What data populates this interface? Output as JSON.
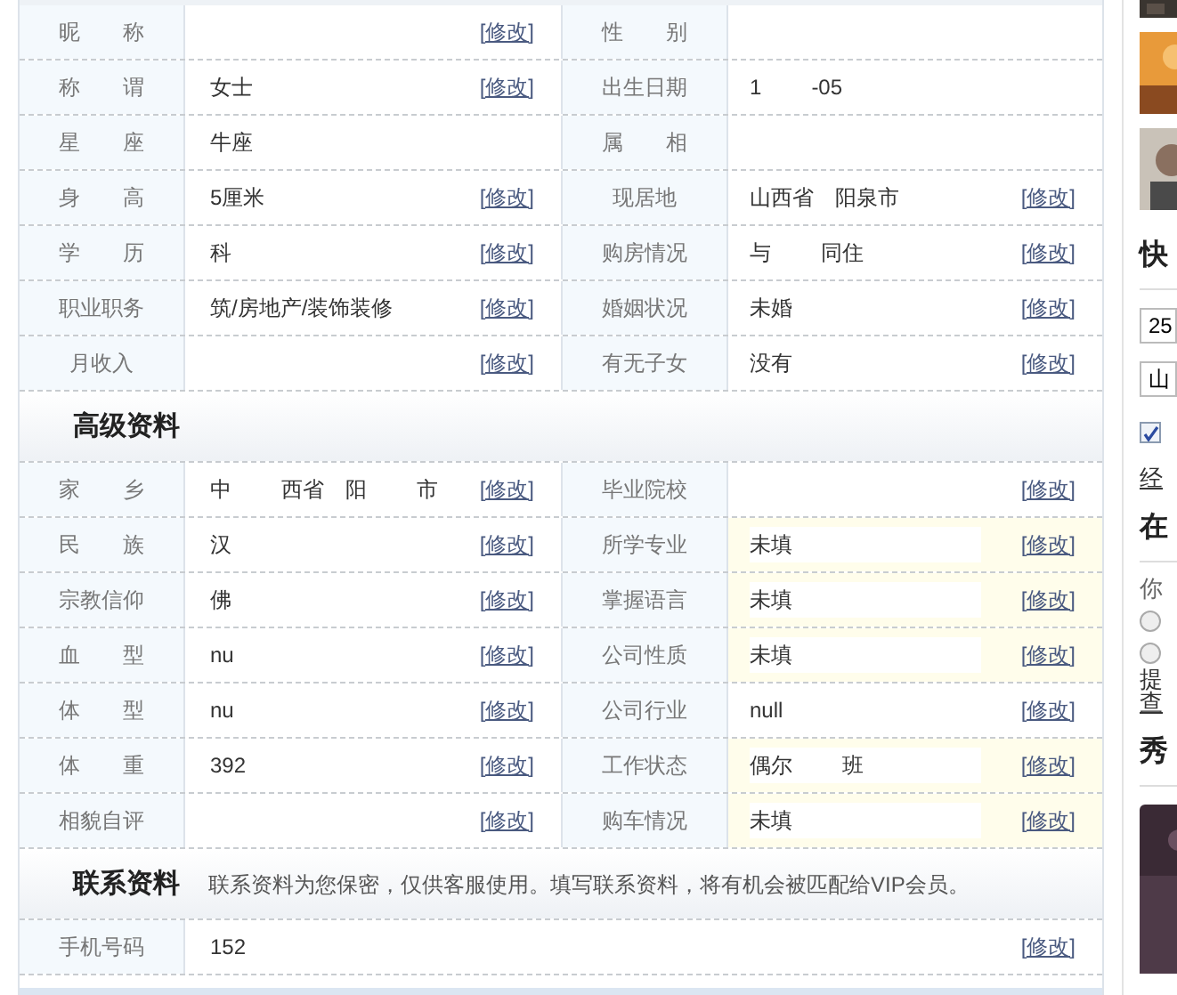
{
  "basic": {
    "rows": [
      {
        "left": {
          "label": "昵　　称",
          "edit": "[修改]"
        },
        "right": {
          "label": "性　　别",
          "highlighted": false
        }
      },
      {
        "left": {
          "label": "称　　谓",
          "value": "女士",
          "edit": "[修改]"
        },
        "right": {
          "label": "出生日期",
          "value": "1",
          "value2": "-05",
          "highlighted": false
        }
      },
      {
        "left": {
          "label": "星　　座",
          "value": "牛座"
        },
        "right": {
          "label": "属　　相",
          "highlighted": false
        }
      },
      {
        "left": {
          "label": "身　　高",
          "value": "5厘米",
          "edit": "[修改]"
        },
        "right": {
          "label": "现居地",
          "value": "山西省　阳泉市",
          "edit": "[修改]",
          "highlighted": false
        }
      },
      {
        "left": {
          "label": "学　　历",
          "value": "科",
          "edit": "[修改]"
        },
        "right": {
          "label": "购房情况",
          "value": "与",
          "value2": "同住",
          "edit": "[修改]",
          "highlighted": false
        }
      },
      {
        "left": {
          "label": "职业职务",
          "value": "筑/房地产/装饰装修",
          "edit": "[修改]"
        },
        "right": {
          "label": "婚姻状况",
          "value": "未婚",
          "edit": "[修改]",
          "highlighted": false
        }
      },
      {
        "left": {
          "label": "月收入",
          "edit": "[修改]"
        },
        "right": {
          "label": "有无子女",
          "value": "没有",
          "edit": "[修改]",
          "highlighted": false
        }
      }
    ]
  },
  "advanced": {
    "title": "高级资料",
    "rows": [
      {
        "left": {
          "label": "家　　乡",
          "value": "中",
          "value2": "西省　阳",
          "value3": "市",
          "edit": "[修改]"
        },
        "right": {
          "label": "毕业院校",
          "edit": "[修改]",
          "highlighted": false
        }
      },
      {
        "left": {
          "label": "民　　族",
          "value": "汉",
          "edit": "[修改]"
        },
        "right": {
          "label": "所学专业",
          "value": "未填",
          "edit": "[修改]",
          "highlighted": true
        }
      },
      {
        "left": {
          "label": "宗教信仰",
          "value": "佛",
          "edit": "[修改]"
        },
        "right": {
          "label": "掌握语言",
          "value": "未填",
          "edit": "[修改]",
          "highlighted": true
        }
      },
      {
        "left": {
          "label": "血　　型",
          "value": "nu",
          "edit": "[修改]"
        },
        "right": {
          "label": "公司性质",
          "value": "未填",
          "edit": "[修改]",
          "highlighted": true
        }
      },
      {
        "left": {
          "label": "体　　型",
          "value": "nu",
          "edit": "[修改]"
        },
        "right": {
          "label": "公司行业",
          "value": "null",
          "edit": "[修改]",
          "highlighted": false
        }
      },
      {
        "left": {
          "label": "体　　重",
          "value": "392",
          "edit": "[修改]"
        },
        "right": {
          "label": "工作状态",
          "value": "偶尔",
          "value2": "班",
          "edit": "[修改]",
          "highlighted": true
        }
      },
      {
        "left": {
          "label": "相貌自评",
          "edit": "[修改]"
        },
        "right": {
          "label": "购车情况",
          "value": "未填",
          "edit": "[修改]",
          "highlighted": true
        }
      }
    ]
  },
  "contact": {
    "title": "联系资料",
    "note": "联系资料为您保密，仅供客服使用。填写联系资料，将有机会被匹配给VIP会员。",
    "rows": [
      {
        "label": "手机号码",
        "value": "152",
        "edit": "[修改]"
      }
    ]
  },
  "sidebar": {
    "heading_1": "快",
    "field_1": "25",
    "field_2": "山",
    "checkbox_checked": true,
    "link_1": "经",
    "heading_2": "在",
    "text_1": "你",
    "radios": [
      {
        "selected": false
      },
      {
        "selected": false
      }
    ],
    "text_2": "提",
    "link_2": "查",
    "heading_3": "秀"
  }
}
